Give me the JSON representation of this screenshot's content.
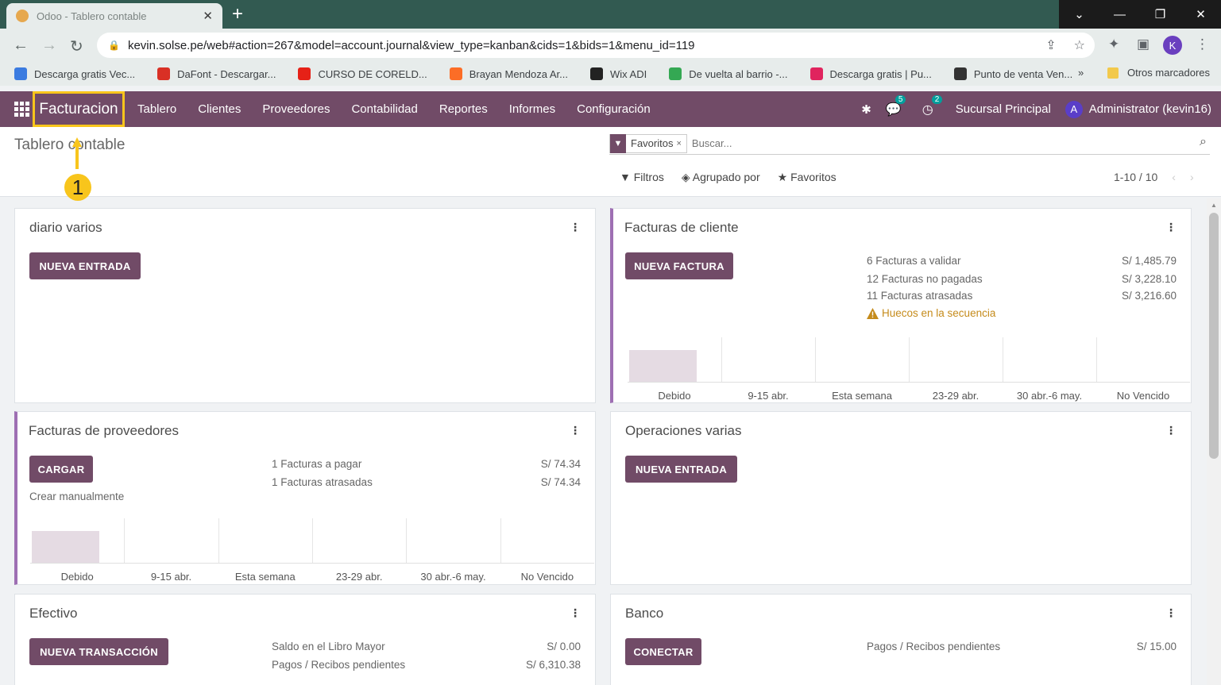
{
  "browser": {
    "tab_title": "Odoo - Tablero contable",
    "tab_close": "✕",
    "new_tab": "+",
    "url": "kevin.solse.pe/web#action=267&model=account.journal&view_type=kanban&cids=1&bids=1&menu_id=119",
    "profile_initial": "K",
    "bookmarks": [
      {
        "label": "Descarga gratis Vec...",
        "color": "#3b7be0"
      },
      {
        "label": "DaFont - Descargar...",
        "color": "#d93025"
      },
      {
        "label": "CURSO DE CORELD...",
        "color": "#e62117"
      },
      {
        "label": "Brayan Mendoza Ar...",
        "color": "#fc6d26"
      },
      {
        "label": "Wix ADI",
        "color": "#222222"
      },
      {
        "label": "De vuelta al barrio -...",
        "color": "#34a853"
      },
      {
        "label": "Descarga gratis | Pu...",
        "color": "#e0245e"
      },
      {
        "label": "Punto de venta Ven...",
        "color": "#333333"
      }
    ],
    "bookmarks_more": "»",
    "other_bookmarks": "Otros marcadores"
  },
  "navbar": {
    "brand": "Facturacion",
    "menu": [
      "Tablero",
      "Clientes",
      "Proveedores",
      "Contabilidad",
      "Reportes",
      "Informes",
      "Configuración"
    ],
    "messages_count": "5",
    "activities_count": "2",
    "branch": "Sucursal Principal",
    "user_initial": "A",
    "user": "Administrator (kevin16)"
  },
  "control_panel": {
    "breadcrumb": "Tablero contable",
    "facet": "Favoritos",
    "facet_remove": "×",
    "search_placeholder": "Buscar...",
    "filters": "Filtros",
    "group_by": "Agrupado por",
    "favorites": "Favoritos",
    "pager": "1-10 / 10",
    "annotation_number": "1"
  },
  "cards": {
    "diario": {
      "title": "diario varios",
      "button": "NUEVA ENTRADA"
    },
    "clientes": {
      "title": "Facturas de cliente",
      "button": "NUEVA FACTURA",
      "stats": [
        {
          "label": "6 Facturas a validar",
          "amount": "S/ 1,485.79"
        },
        {
          "label": "12 Facturas no pagadas",
          "amount": "S/ 3,228.10"
        },
        {
          "label": "11 Facturas atrasadas",
          "amount": "S/ 3,216.60"
        }
      ],
      "warning": "Huecos en la secuencia"
    },
    "proveedores": {
      "title": "Facturas de proveedores",
      "button": "CARGAR",
      "manual": "Crear manualmente",
      "stats": [
        {
          "label": "1 Facturas a pagar",
          "amount": "S/ 74.34"
        },
        {
          "label": "1 Facturas atrasadas",
          "amount": "S/ 74.34"
        }
      ]
    },
    "operaciones": {
      "title": "Operaciones varias",
      "button": "NUEVA ENTRADA"
    },
    "efectivo": {
      "title": "Efectivo",
      "button": "NUEVA TRANSACCIÓN",
      "stats": [
        {
          "label": "Saldo en el Libro Mayor",
          "amount": "S/ 0.00"
        },
        {
          "label": "Pagos / Recibos pendientes",
          "amount": "S/ 6,310.38"
        }
      ]
    },
    "banco": {
      "title": "Banco",
      "button": "CONECTAR",
      "stats": [
        {
          "label": "Pagos / Recibos pendientes",
          "amount": "S/ 15.00"
        }
      ]
    }
  },
  "chart_data": [
    {
      "type": "bar",
      "categories": [
        "Debido",
        "9-15 abr.",
        "Esta semana",
        "23-29 abr.",
        "30 abr.-6 may.",
        "No Vencido"
      ],
      "values": [
        1,
        0,
        0,
        0,
        0,
        0
      ]
    },
    {
      "type": "bar",
      "categories": [
        "Debido",
        "9-15 abr.",
        "Esta semana",
        "23-29 abr.",
        "30 abr.-6 may.",
        "No Vencido"
      ],
      "values": [
        1,
        0,
        0,
        0,
        0,
        0
      ]
    }
  ]
}
